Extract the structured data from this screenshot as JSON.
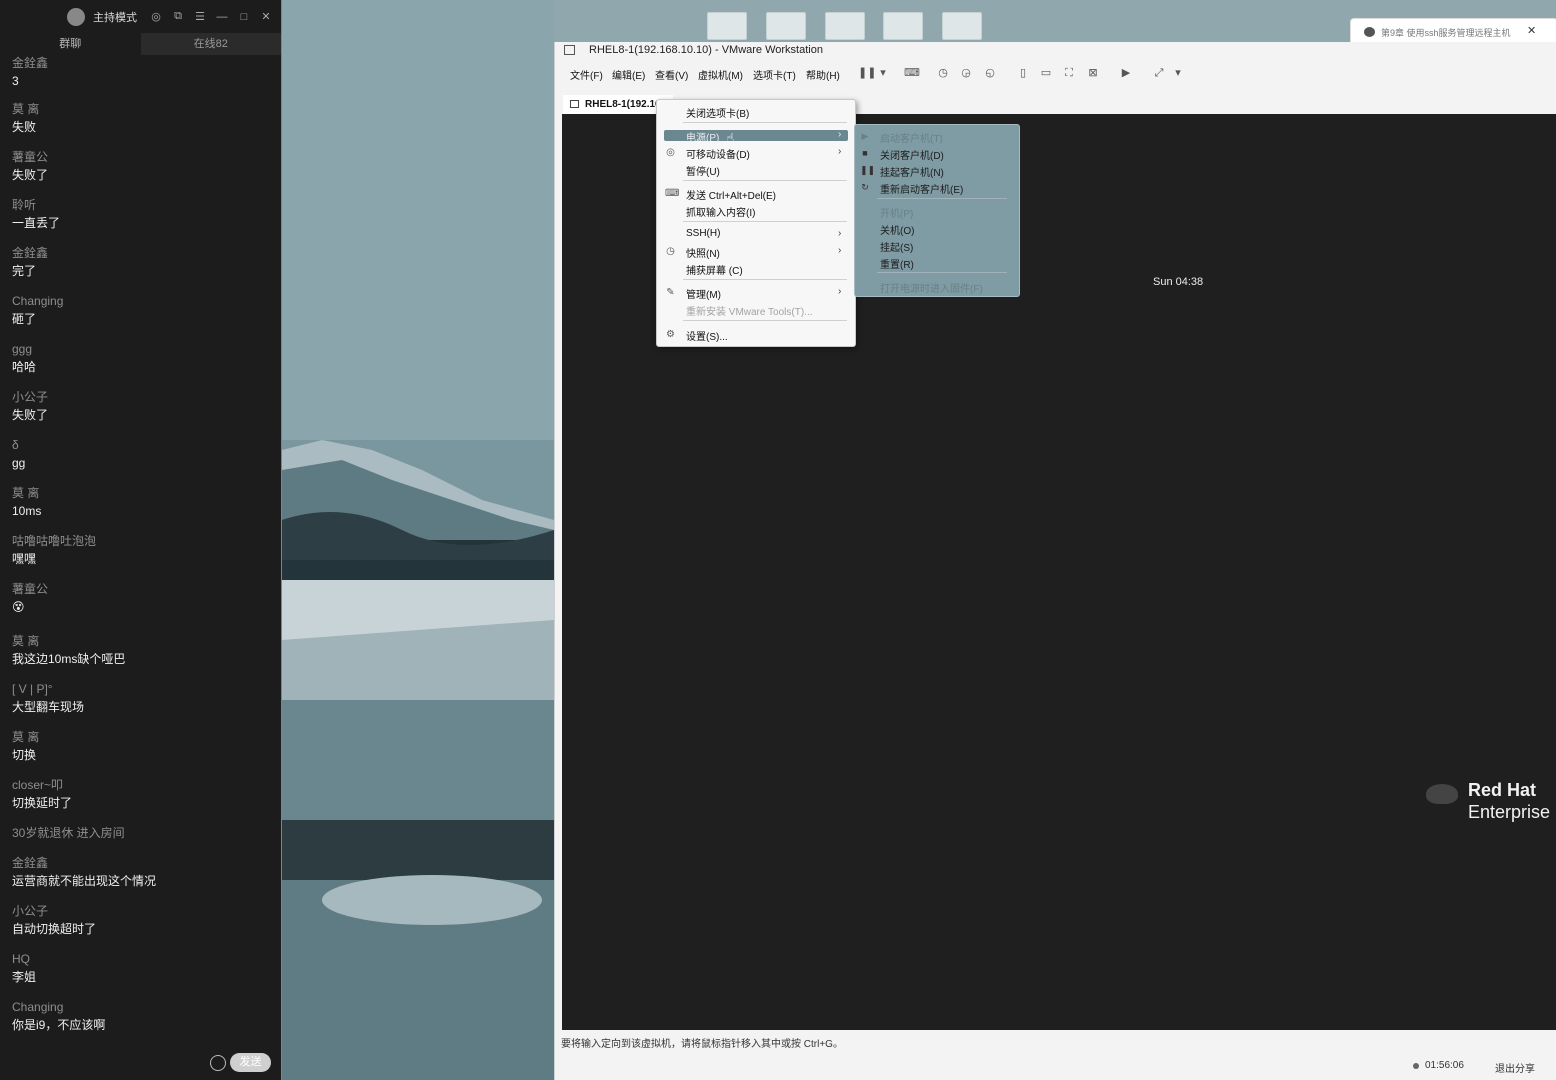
{
  "chat": {
    "mode_label": "主持模式",
    "tabs": [
      "群聊",
      "在线82"
    ],
    "send_label": "发送",
    "messages": [
      {
        "nick": "金銓鑫",
        "text": "3"
      },
      {
        "nick": "莫 离",
        "text": "失败"
      },
      {
        "nick": "薯童公",
        "text": "失败了"
      },
      {
        "nick": "聆听",
        "text": "一直丢了"
      },
      {
        "nick": "金銓鑫",
        "text": "完了"
      },
      {
        "nick": "Changing",
        "text": "砸了"
      },
      {
        "nick": "ggg",
        "text": "哈哈"
      },
      {
        "nick": "小公子",
        "text": "失败了"
      },
      {
        "nick": "δ",
        "text": "gg"
      },
      {
        "nick": "莫 离",
        "text": "10ms"
      },
      {
        "nick": "咕噜咕噜吐泡泡",
        "text": "嘿嘿"
      },
      {
        "nick": "薯童公",
        "text": "😵"
      },
      {
        "nick": "莫 离",
        "text": "我这边10ms缺个哑巴"
      },
      {
        "nick": "[ V | P]°",
        "text": "大型翻车现场"
      },
      {
        "nick": "莫 离",
        "text": "切换"
      },
      {
        "nick": "closer~叩",
        "text": "切换延时了"
      },
      {
        "nick": "30岁就退休 进入房间",
        "text": ""
      },
      {
        "nick": "金銓鑫",
        "text": "运营商就不能出现这个情况"
      },
      {
        "nick": "小公子",
        "text": "自动切换超时了"
      },
      {
        "nick": "HQ",
        "text": "李姐"
      },
      {
        "nick": "Changing",
        "text": "你是i9，不应该啊"
      }
    ]
  },
  "notification": {
    "text": "第9章 使用ssh服务管理远程主机"
  },
  "vmware": {
    "title": "RHEL8-1(192.168.10.10) - VMware Workstation",
    "menu": [
      "文件(F)",
      "编辑(E)",
      "查看(V)",
      "虚拟机(M)",
      "选项卡(T)",
      "帮助(H)"
    ],
    "tab_label": "RHEL8-1(192.168.10.10)",
    "clock": "Sun 04:38",
    "brand_line1": "Red Hat",
    "brand_line2": "Enterprise",
    "status_text": "要将输入定向到该虚拟机，请将鼠标指针移入其中或按 Ctrl+G。",
    "timer": "01:56:06",
    "share_exit": "退出分享"
  },
  "context_menu": {
    "items": [
      {
        "label": "关闭选项卡(B)"
      },
      {
        "label": "电源(P)",
        "highlighted": true,
        "arrow": true
      },
      {
        "label": "可移动设备(D)",
        "arrow": true,
        "icon": "device-icon"
      },
      {
        "label": "暂停(U)"
      },
      {
        "label": "发送 Ctrl+Alt+Del(E)",
        "icon": "keyboard-icon"
      },
      {
        "label": "抓取输入内容(I)"
      },
      {
        "label": "SSH(H)",
        "arrow": true
      },
      {
        "label": "快照(N)",
        "arrow": true,
        "icon": "snapshot-icon"
      },
      {
        "label": "捕获屏幕 (C)"
      },
      {
        "label": "管理(M)",
        "arrow": true,
        "icon": "wrench-icon"
      },
      {
        "label": "重新安装 VMware Tools(T)...",
        "disabled": true
      },
      {
        "label": "设置(S)...",
        "icon": "settings-icon"
      }
    ]
  },
  "power_submenu": {
    "items": [
      {
        "label": "启动客户机(T)",
        "disabled": true,
        "icon": "play-icon"
      },
      {
        "label": "关闭客户机(D)",
        "icon": "stop-icon"
      },
      {
        "label": "挂起客户机(N)",
        "icon": "pause-icon"
      },
      {
        "label": "重新启动客户机(E)",
        "icon": "restart-icon"
      },
      {
        "label": "开机(P)",
        "disabled": true
      },
      {
        "label": "关机(O)"
      },
      {
        "label": "挂起(S)"
      },
      {
        "label": "重置(R)"
      },
      {
        "label": "打开电源时进入固件(F)",
        "disabled": true
      }
    ]
  }
}
